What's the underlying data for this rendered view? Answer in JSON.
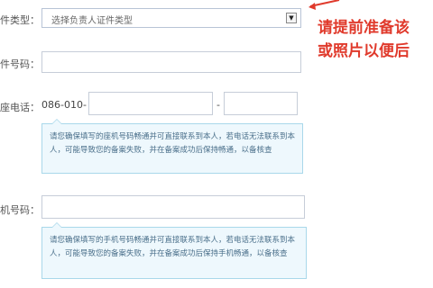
{
  "form": {
    "cert_type_label": "件类型：",
    "cert_type_select": "选择负责人证件类型",
    "cert_number_label": "件号码：",
    "landline_label": "座电话：",
    "landline_prefix": "086-010-",
    "landline_dash": "-",
    "landline_tip": "请您确保填写的座机号码畅通并可直接联系到本人，若电话无法联系到本人，可能导致您的备案失败，并在备案成功后保持畅通，以备核查",
    "mobile_label": "机号码：",
    "mobile_tip": "请您确保填写的手机号码畅通并可直接联系到本人，若电话无法联系到本人，可能导致您的备案失败，并在备案成功后保持手机畅通，以备核查"
  },
  "annotation": {
    "line1": "请提前准备该",
    "line2": "或照片以便后",
    "color": "#e03a2c"
  },
  "icons": {
    "select_arrow": "dropdown-arrow-icon"
  }
}
